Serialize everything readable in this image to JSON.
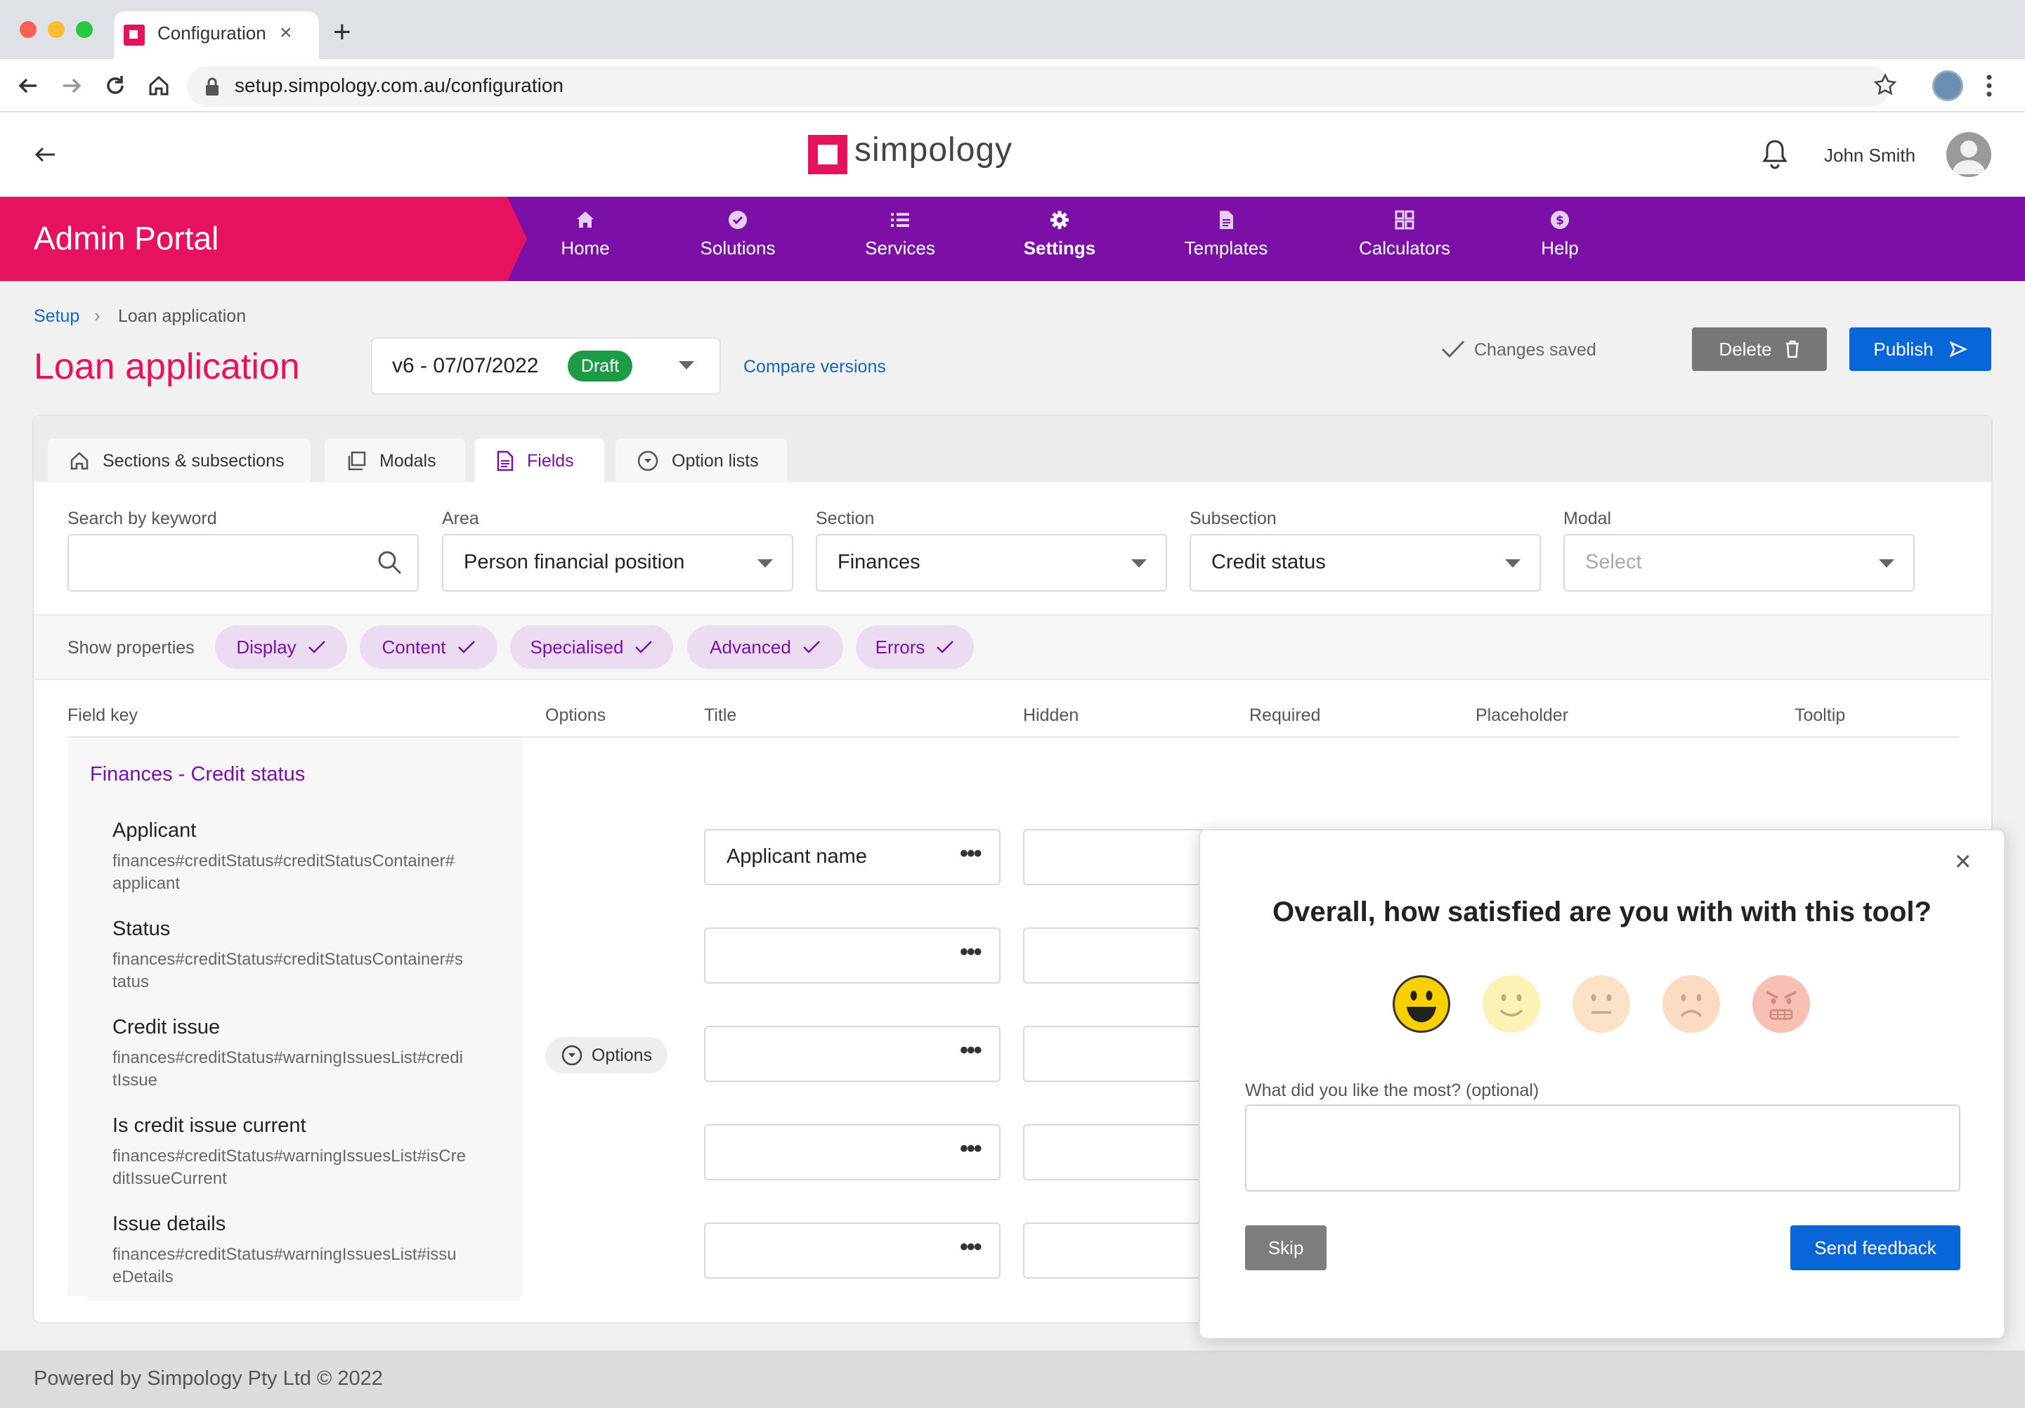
{
  "browser": {
    "tab_title": "Configuration",
    "url": "setup.simpology.com.au/configuration"
  },
  "header": {
    "logo_text": "simpology",
    "user_name": "John Smith"
  },
  "nav": {
    "portal_title": "Admin Portal",
    "items": [
      {
        "label": "Home",
        "icon": "home-icon"
      },
      {
        "label": "Solutions",
        "icon": "check-circle-icon"
      },
      {
        "label": "Services",
        "icon": "list-icon"
      },
      {
        "label": "Settings",
        "icon": "gear-icon"
      },
      {
        "label": "Templates",
        "icon": "document-icon"
      },
      {
        "label": "Calculators",
        "icon": "grid-icon"
      },
      {
        "label": "Help",
        "icon": "dollar-circle-icon"
      }
    ]
  },
  "breadcrumb": {
    "root": "Setup",
    "current": "Loan application"
  },
  "page": {
    "title": "Loan application",
    "version": "v6 - 07/07/2022",
    "version_status": "Draft",
    "compare_link": "Compare versions",
    "saved_status": "Changes saved",
    "delete_label": "Delete",
    "publish_label": "Publish"
  },
  "tabs": [
    {
      "label": "Sections & subsections",
      "icon": "home-icon"
    },
    {
      "label": "Modals",
      "icon": "modal-icon"
    },
    {
      "label": "Fields",
      "icon": "document-icon",
      "active": true
    },
    {
      "label": "Option lists",
      "icon": "chevron-circle-icon"
    }
  ],
  "filters": {
    "search": {
      "label": "Search by keyword",
      "value": ""
    },
    "area": {
      "label": "Area",
      "value": "Person financial position"
    },
    "section": {
      "label": "Section",
      "value": "Finances"
    },
    "subsection": {
      "label": "Subsection",
      "value": "Credit status"
    },
    "modal": {
      "label": "Modal",
      "placeholder": "Select"
    }
  },
  "properties": {
    "label": "Show properties",
    "chips": [
      "Display",
      "Content",
      "Specialised",
      "Advanced",
      "Errors"
    ]
  },
  "table": {
    "columns": [
      "Field key",
      "Options",
      "Title",
      "Hidden",
      "Required",
      "Placeholder",
      "Tooltip"
    ],
    "group_title": "Finances - Credit status",
    "options_button": "Options",
    "rows": [
      {
        "name": "Applicant",
        "key_line1": "finances#creditStatus#creditStatusContainer#",
        "key_line2": "applicant",
        "title": "Applicant name"
      },
      {
        "name": "Status",
        "key_line1": "finances#creditStatus#creditStatusContainer#s",
        "key_line2": "tatus",
        "title": ""
      },
      {
        "name": "Credit issue",
        "key_line1": "finances#creditStatus#warningIssuesList#credi",
        "key_line2": "tIssue",
        "title": ""
      },
      {
        "name": "Is credit issue current",
        "key_line1": "finances#creditStatus#warningIssuesList#isCre",
        "key_line2": "ditIssueCurrent",
        "title": ""
      },
      {
        "name": "Issue details",
        "key_line1": "finances#creditStatus#warningIssuesList#issu",
        "key_line2": "eDetails",
        "title": ""
      }
    ]
  },
  "feedback": {
    "question": "Overall, how satisfied are you with with this tool?",
    "faces": [
      "very-satisfied-face-icon",
      "satisfied-face-icon",
      "neutral-face-icon",
      "dissatisfied-face-icon",
      "angry-face-icon"
    ],
    "like_label": "What did you like the most? (optional)",
    "like_value": "",
    "skip_label": "Skip",
    "send_label": "Send feedback"
  },
  "footer": {
    "text": "Powered by Simpology Pty Ltd © 2022"
  },
  "colors": {
    "brand_pink": "#e6125d",
    "brand_purple": "#7b0fa6",
    "primary_blue": "#0866d6",
    "draft_green": "#1e9b46"
  }
}
